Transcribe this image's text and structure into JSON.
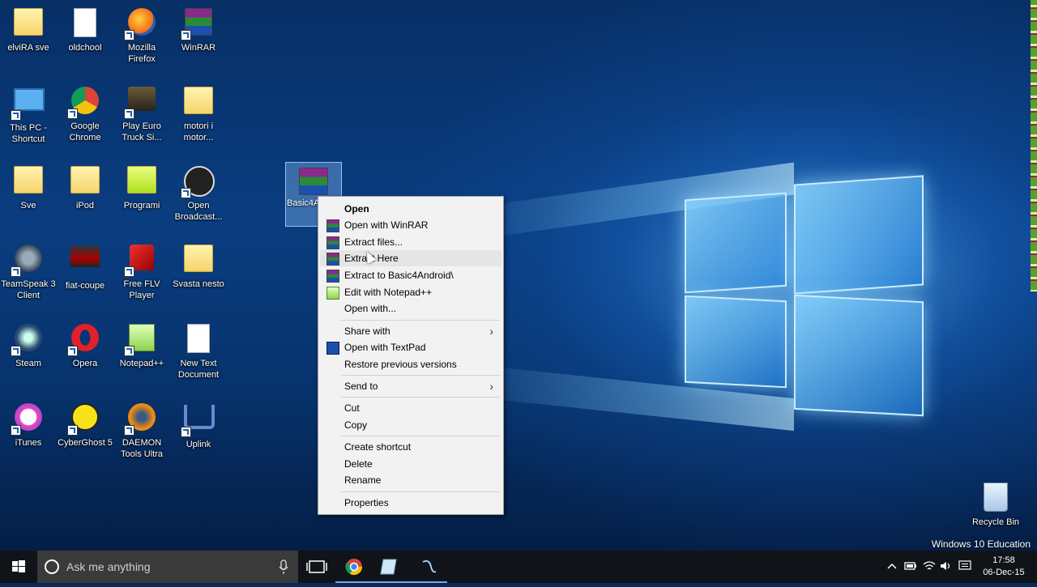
{
  "desktop": {
    "icons": [
      {
        "label": "elviRA sve"
      },
      {
        "label": "oldchool"
      },
      {
        "label": "Mozilla Firefox"
      },
      {
        "label": "WinRAR"
      },
      {
        "label": "This PC - Shortcut"
      },
      {
        "label": "Google Chrome"
      },
      {
        "label": "Play Euro Truck Si..."
      },
      {
        "label": "motori i motor..."
      },
      {
        "label": "Sve"
      },
      {
        "label": "iPod"
      },
      {
        "label": "Programi"
      },
      {
        "label": "Open Broadcast..."
      },
      {
        "label": "TeamSpeak 3 Client"
      },
      {
        "label": "fiat-coupe"
      },
      {
        "label": "Free FLV Player"
      },
      {
        "label": "Svasta nesto"
      },
      {
        "label": "Steam"
      },
      {
        "label": "Opera"
      },
      {
        "label": "Notepad++"
      },
      {
        "label": "New Text Document"
      },
      {
        "label": "iTunes"
      },
      {
        "label": "CyberGhost 5"
      },
      {
        "label": "DAEMON Tools Ultra"
      },
      {
        "label": "Uplink"
      }
    ],
    "selected_icon_label": "Basic4A... d",
    "recycle_bin_label": "Recycle Bin",
    "watermark": "Windows 10 Education"
  },
  "context_menu": {
    "items": [
      {
        "label": "Open"
      },
      {
        "label": "Open with WinRAR"
      },
      {
        "label": "Extract files..."
      },
      {
        "label": "Extract Here"
      },
      {
        "label": "Extract to Basic4Android\\"
      },
      {
        "label": "Edit with Notepad++"
      },
      {
        "label": "Open with..."
      },
      {
        "label": "Share with"
      },
      {
        "label": "Open with TextPad"
      },
      {
        "label": "Restore previous versions"
      },
      {
        "label": "Send to"
      },
      {
        "label": "Cut"
      },
      {
        "label": "Copy"
      },
      {
        "label": "Create shortcut"
      },
      {
        "label": "Delete"
      },
      {
        "label": "Rename"
      },
      {
        "label": "Properties"
      }
    ]
  },
  "taskbar": {
    "search_placeholder": "Ask me anything",
    "time": "17:58",
    "date": "06-Dec-15"
  }
}
